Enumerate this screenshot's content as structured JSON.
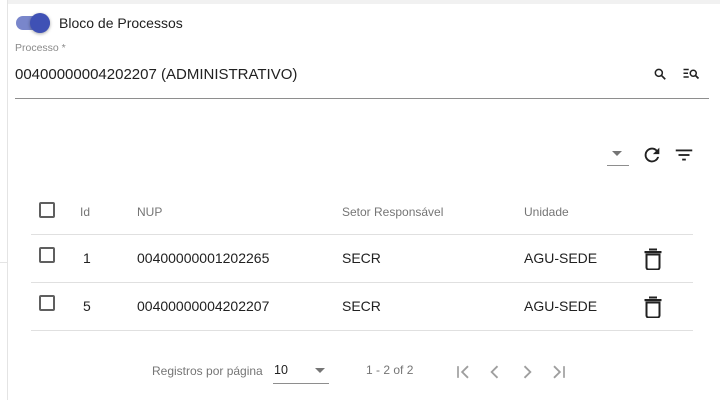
{
  "toggle": {
    "label": "Bloco de Processos",
    "checked": true,
    "track_color": "#7986cb",
    "thumb_color": "#3f51b5"
  },
  "process_field": {
    "label": "Processo *",
    "value": "00400000004202207 (ADMINISTRATIVO)",
    "icons": [
      "search-icon",
      "advanced-search-icon"
    ]
  },
  "toolbar": {
    "icons": [
      "dropdown-arrow-icon",
      "refresh-icon",
      "filter-icon"
    ]
  },
  "table": {
    "headers": {
      "id": "Id",
      "nup": "NUP",
      "setor": "Setor Responsável",
      "unidade": "Unidade"
    },
    "rows": [
      {
        "id": "1",
        "nup": "00400000001202265",
        "setor": "SECR",
        "unidade": "AGU-SEDE"
      },
      {
        "id": "5",
        "nup": "00400000004202207",
        "setor": "SECR",
        "unidade": "AGU-SEDE"
      }
    ]
  },
  "paginator": {
    "label": "Registros por página",
    "page_size": "10",
    "range": "1 - 2 of 2",
    "icons": [
      "first-page-icon",
      "previous-page-icon",
      "next-page-icon",
      "last-page-icon"
    ]
  }
}
